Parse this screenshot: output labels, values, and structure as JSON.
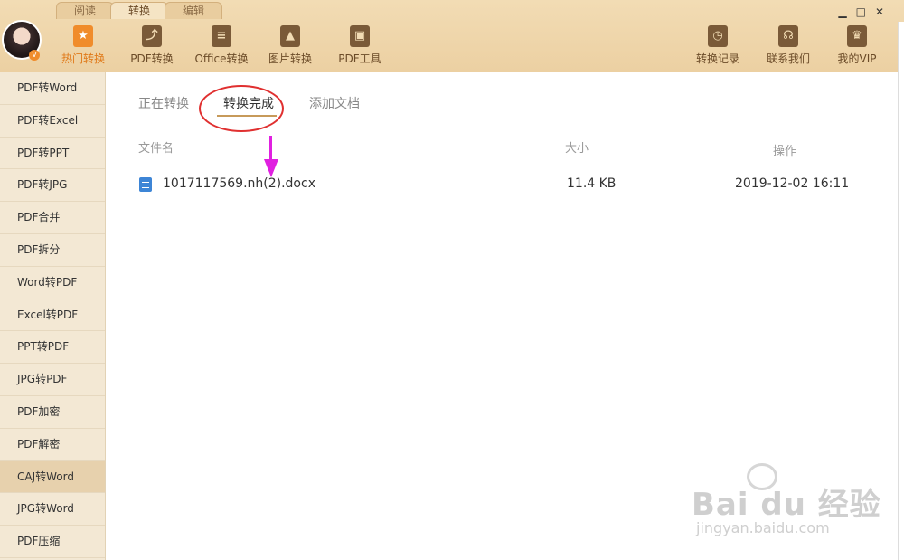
{
  "app_tabs": [
    "阅读",
    "转换",
    "编辑"
  ],
  "window_controls": [
    "▁",
    "□",
    "✕"
  ],
  "toolbar": [
    {
      "label": "热门转换",
      "icon": "star-icon",
      "glyph": "★",
      "active": true
    },
    {
      "label": "PDF转换",
      "icon": "pdf-icon",
      "glyph": "⤴"
    },
    {
      "label": "Office转换",
      "icon": "document-icon",
      "glyph": "≡"
    },
    {
      "label": "图片转换",
      "icon": "image-icon",
      "glyph": "▲"
    },
    {
      "label": "PDF工具",
      "icon": "toolbox-icon",
      "glyph": "▣"
    },
    {
      "label": "转换记录",
      "icon": "clock-icon",
      "glyph": "◷"
    },
    {
      "label": "联系我们",
      "icon": "headset-icon",
      "glyph": "☊"
    },
    {
      "label": "我的VIP",
      "icon": "crown-icon",
      "glyph": "♛"
    }
  ],
  "avatar_badge": "V",
  "sidebar": {
    "items": [
      "PDF转Word",
      "PDF转Excel",
      "PDF转PPT",
      "PDF转JPG",
      "PDF合并",
      "PDF拆分",
      "Word转PDF",
      "Excel转PDF",
      "PPT转PDF",
      "JPG转PDF",
      "PDF加密",
      "PDF解密",
      "CAJ转Word",
      "JPG转Word",
      "PDF压缩"
    ],
    "active_index": 12
  },
  "subtabs": [
    "正在转换",
    "转换完成",
    "添加文档"
  ],
  "columns": {
    "name": "文件名",
    "size": "大小",
    "action": "操作"
  },
  "files": [
    {
      "name": "1017117569.nh(2).docx",
      "size": "11.4 KB",
      "date": "2019-12-02 16:11"
    }
  ],
  "watermark": {
    "logo": "Bai du 经验",
    "url": "jingyan.baidu.com"
  }
}
